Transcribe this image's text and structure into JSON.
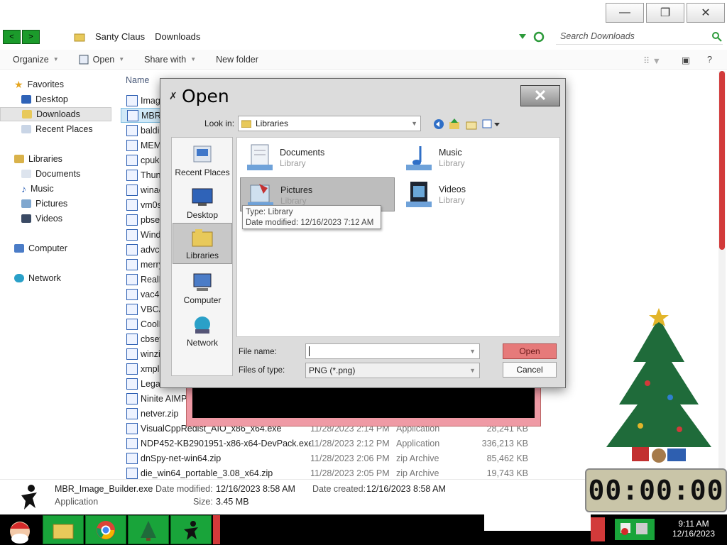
{
  "window": {
    "minimize_glyph": "—",
    "restore_glyph": "❐",
    "close_glyph": "✕"
  },
  "address": {
    "back_glyph": "<",
    "forward_glyph": ">",
    "breadcrumb": [
      "Santy Claus",
      "Downloads"
    ],
    "search_placeholder": "Search Downloads"
  },
  "toolbar": {
    "organize": "Organize",
    "open": "Open",
    "share_with": "Share with",
    "new_folder": "New folder",
    "help": "?"
  },
  "nav": {
    "favorites": "Favorites",
    "desktop": "Desktop",
    "downloads": "Downloads",
    "recent_places": "Recent Places",
    "libraries": "Libraries",
    "documents": "Documents",
    "music": "Music",
    "pictures": "Pictures",
    "videos": "Videos",
    "computer": "Computer",
    "network": "Network"
  },
  "columns": {
    "name": "Name"
  },
  "files": [
    {
      "name": "Imag",
      "date": "",
      "type": "",
      "size": ""
    },
    {
      "name": "MBR_",
      "date": "",
      "type": "",
      "size": ""
    },
    {
      "name": "baldi",
      "date": "",
      "type": "",
      "size": ""
    },
    {
      "name": "MEM",
      "date": "",
      "type": "",
      "size": ""
    },
    {
      "name": "cpuki",
      "date": "",
      "type": "",
      "size": ""
    },
    {
      "name": "Thun",
      "date": "",
      "type": "",
      "size": ""
    },
    {
      "name": "winae",
      "date": "",
      "type": "",
      "size": ""
    },
    {
      "name": "vm0s",
      "date": "",
      "type": "",
      "size": ""
    },
    {
      "name": "pbset",
      "date": "",
      "type": "",
      "size": ""
    },
    {
      "name": "Wind",
      "date": "",
      "type": "",
      "size": ""
    },
    {
      "name": "advch",
      "date": "",
      "type": "",
      "size": ""
    },
    {
      "name": "merry",
      "date": "",
      "type": "",
      "size": ""
    },
    {
      "name": "RealP",
      "date": "",
      "type": "",
      "size": ""
    },
    {
      "name": "vac47",
      "date": "",
      "type": "",
      "size": ""
    },
    {
      "name": "VBCA",
      "date": "",
      "type": "",
      "size": ""
    },
    {
      "name": "CoolF",
      "date": "",
      "type": "",
      "size": ""
    },
    {
      "name": "cbset",
      "date": "",
      "type": "",
      "size": ""
    },
    {
      "name": "winzi",
      "date": "",
      "type": "",
      "size": ""
    },
    {
      "name": "xmpla",
      "date": "",
      "type": "",
      "size": ""
    },
    {
      "name": "Legac",
      "date": "",
      "type": "",
      "size": ""
    },
    {
      "name": "Ninite AIMP",
      "date": "",
      "type": "",
      "size": ""
    },
    {
      "name": "netver.zip",
      "date": "",
      "type": "",
      "size": ""
    },
    {
      "name": "VisualCppRedist_AIO_x86_x64.exe",
      "date": "11/28/2023 2:14 PM",
      "type": "Application",
      "size": "28,241 KB"
    },
    {
      "name": "NDP452-KB2901951-x86-x64-DevPack.exe",
      "date": "11/28/2023 2:12 PM",
      "type": "Application",
      "size": "336,213 KB"
    },
    {
      "name": "dnSpy-net-win64.zip",
      "date": "11/28/2023 2:06 PM",
      "type": "zip Archive",
      "size": "85,462 KB"
    },
    {
      "name": "die_win64_portable_3.08_x64.zip",
      "date": "11/28/2023 2:05 PM",
      "type": "zip Archive",
      "size": "19,743 KB"
    }
  ],
  "details": {
    "name": "MBR_Image_Builder.exe",
    "modified_label": "Date modified:",
    "modified": "12/16/2023 8:58 AM",
    "created_label": "Date created:",
    "created": "12/16/2023 8:58 AM",
    "type": "Application",
    "size_label": "Size:",
    "size": "3.45 MB"
  },
  "dialog": {
    "title": "Open",
    "close_glyph": "✕",
    "look_in_label": "Look in:",
    "look_in_value": "Libraries",
    "places": [
      "Recent Places",
      "Desktop",
      "Libraries",
      "Computer",
      "Network"
    ],
    "selected_place": "Libraries",
    "libraries": [
      {
        "name": "Documents",
        "sub": "Library"
      },
      {
        "name": "Music",
        "sub": "Library"
      },
      {
        "name": "Pictures",
        "sub": "Library"
      },
      {
        "name": "Videos",
        "sub": "Library"
      }
    ],
    "tooltip_type": "Type: Library",
    "tooltip_date": "Date modified: 12/16/2023 7:12 AM",
    "file_name_label": "File name:",
    "file_name_value": "",
    "file_type_label": "Files of type:",
    "file_type_value": "PNG (*.png)",
    "open_button": "Open",
    "cancel_button": "Cancel"
  },
  "timer": "00:00:00",
  "clock": {
    "time": "9:11 AM",
    "date": "12/16/2023"
  },
  "colors": {
    "accent_red": "#d23a3a",
    "taskbar_green": "#19a43a",
    "dialog_bg": "#dcdcdc"
  }
}
